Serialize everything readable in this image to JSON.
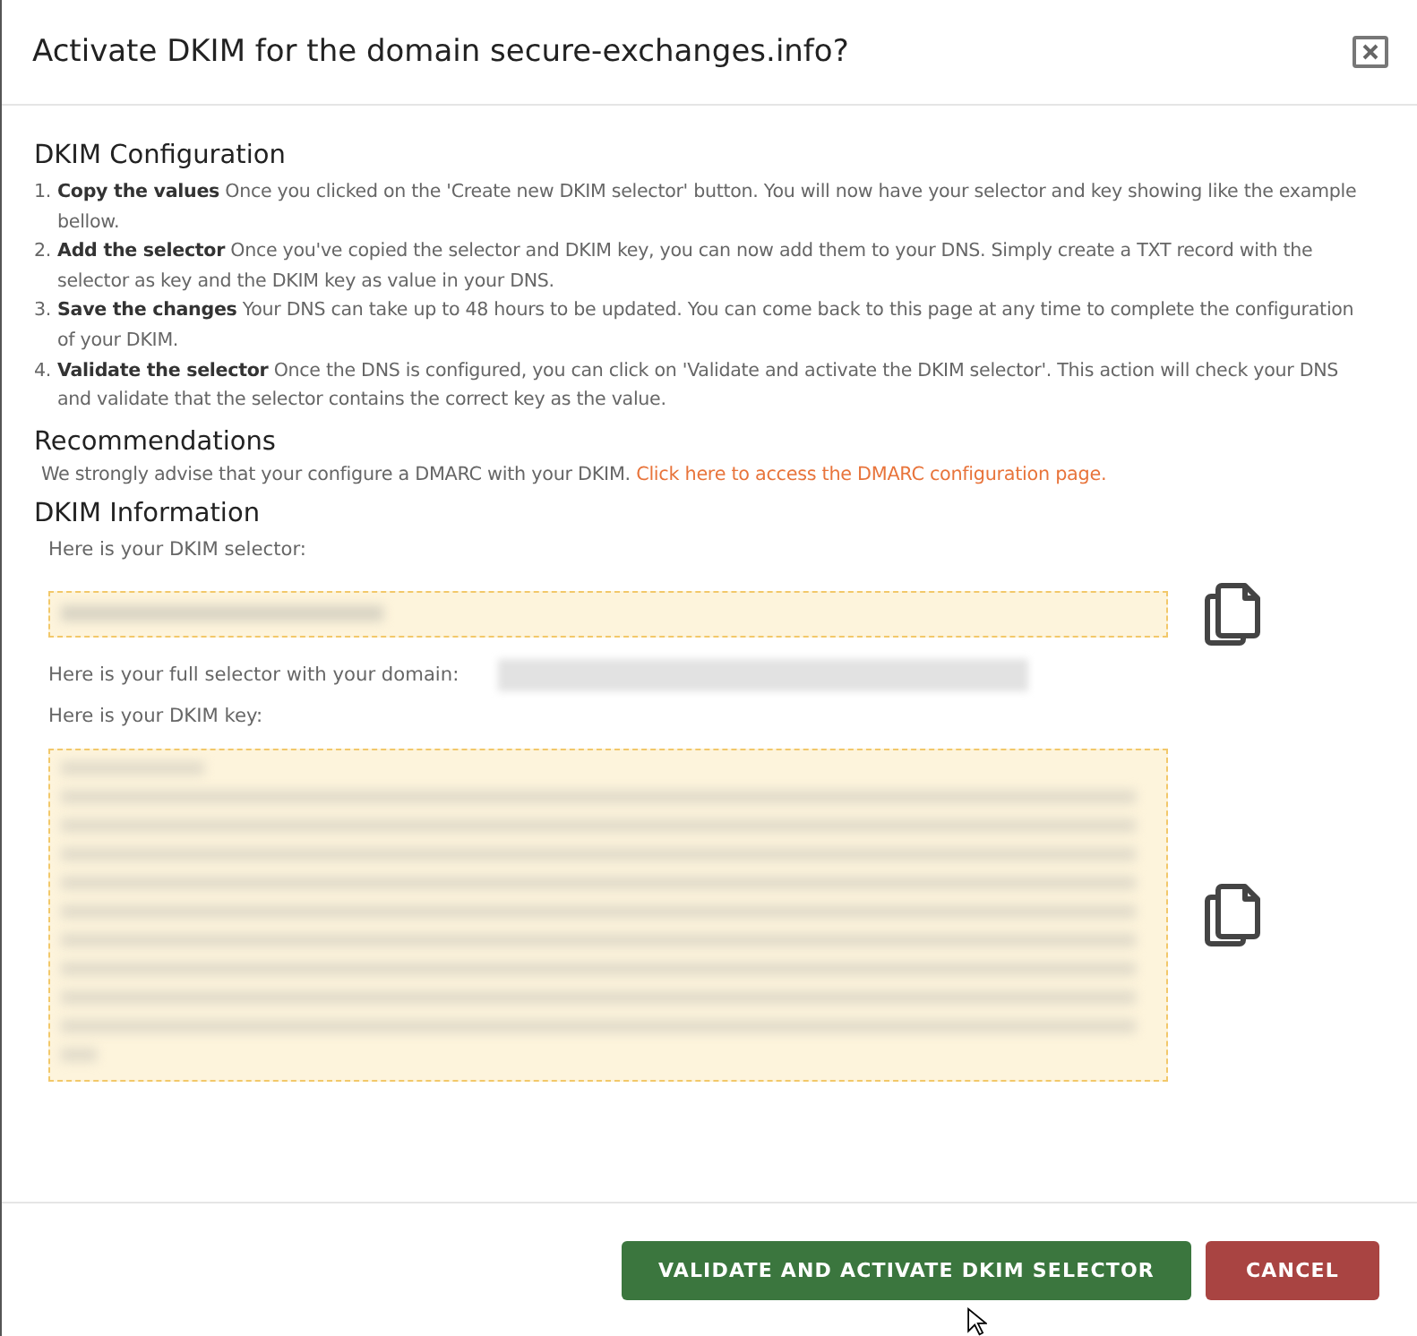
{
  "dialog": {
    "title": "Activate DKIM for the domain secure-exchanges.info?"
  },
  "configuration": {
    "heading": "DKIM Configuration",
    "steps": [
      {
        "number": "1.",
        "text": "**Copy the values** Once you clicked on the 'Create new DKIM selector' button. You will now have your selector and key showing like the example bellow."
      },
      {
        "number": "2.",
        "text": "**Add the selector** Once you've copied the selector and DKIM key, you can now add them to your DNS. Simply create a TXT record with the selector as key and the DKIM key as value in your DNS."
      },
      {
        "number": "3.",
        "text": "**Save the changes** Your DNS can take up to 48 hours to be updated. You can come back to this page at any time to complete the configuration of your DKIM."
      },
      {
        "number": "4.",
        "text": "**Validate the selector** Once the DNS is configured, you can click on 'Validate and activate the DKIM selector'. This action will check your DNS and validate that the selector contains the correct key as the value."
      }
    ]
  },
  "recommendations": {
    "heading": "Recommendations",
    "text": "We strongly advise that your configure a DMARC with your DKIM.",
    "link": "Click here to access the DMARC configuration page."
  },
  "information": {
    "heading": "DKIM Information",
    "selector_label": "Here is your DKIM selector:",
    "full_selector_label": "Here is your full selector with your domain:",
    "key_label": "Here is your DKIM key:"
  },
  "buttons": [
    {
      "label": "VALIDATE AND ACTIVATE DKIM SELECTOR",
      "kind": "primary"
    },
    {
      "label": "CANCEL",
      "kind": "cancel"
    }
  ]
}
